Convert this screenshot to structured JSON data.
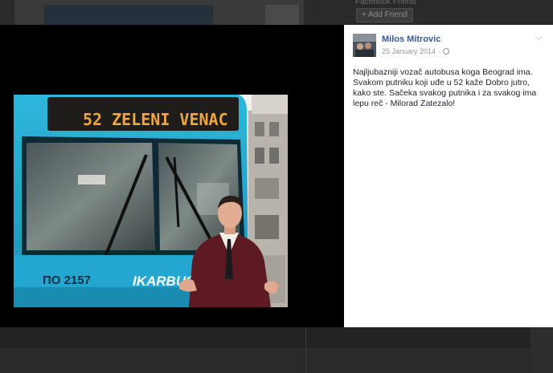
{
  "background_page": {
    "friend_name": "Facebook Friend",
    "add_friend_label": "Add Friend"
  },
  "post": {
    "author": "Milos Mitrovic",
    "date": "25 January 2014",
    "separator": "·",
    "text": "Najljubazniji vozač autobusa koga Beograd ima. Svakom putniku koji uđe u 52 kaže Dobro jutro, kako ste. Sačeka svakog putnika i za svakog ima lepu reč - Milorad Zatezalo!"
  },
  "photo": {
    "bus_sign": "52 ZELENI VENAC",
    "bus_plate": "ПО 2157",
    "bus_brand": "IKARBUS"
  },
  "icons": {
    "privacy": "globe-icon",
    "menu": "chevron-down-icon"
  }
}
